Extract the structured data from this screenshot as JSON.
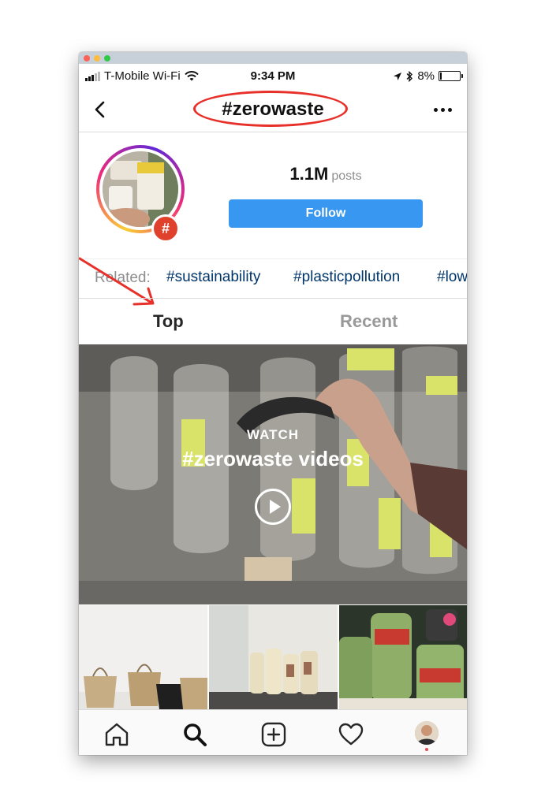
{
  "status_bar": {
    "carrier": "T-Mobile Wi-Fi",
    "time": "9:34 PM",
    "battery_percent": "8%",
    "battery_level": 0.08
  },
  "header": {
    "title": "#zerowaste",
    "back_icon": "chevron-left-icon",
    "more_icon": "more-horizontal-icon"
  },
  "profile": {
    "posts_count": "1.1M",
    "posts_label": "posts",
    "follow_label": "Follow",
    "badge_symbol": "#"
  },
  "related": {
    "label": "Related:",
    "tags": [
      "#sustainability",
      "#plasticpollution",
      "#low"
    ]
  },
  "tabs": [
    {
      "label": "Top",
      "active": true
    },
    {
      "label": "Recent",
      "active": false
    }
  ],
  "video": {
    "overline": "WATCH",
    "title": "#zerowaste videos",
    "play_icon": "play-circle-icon"
  },
  "bottom_nav": {
    "items": [
      "home-icon",
      "search-icon",
      "add-post-icon",
      "heart-icon",
      "profile-avatar"
    ]
  },
  "colors": {
    "accent": "#3897f0",
    "annotation": "#e8302a",
    "tag_link": "#003569",
    "badge": "#e0412c"
  }
}
